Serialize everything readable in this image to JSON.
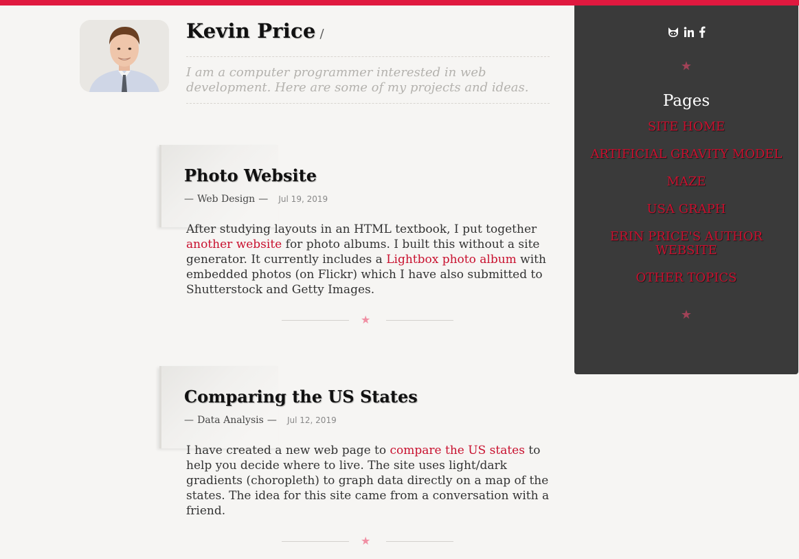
{
  "header": {
    "name": "Kevin Price",
    "slash": "/",
    "tagline": "I am a computer programmer interested in web development. Here are some of my projects and ideas."
  },
  "posts": [
    {
      "title": "Photo Website",
      "dash_left": "—",
      "category": "Web Design",
      "dash_right": "—",
      "date": "Jul 19, 2019",
      "body": {
        "t1": "After studying layouts in an HTML textbook, I put together ",
        "link1": "another website",
        "t2": " for photo albums. I built this without a site generator. It currently includes a ",
        "link2": "Lightbox photo album",
        "t3": " with embedded photos (on Flickr) which I have also submitted to Shutterstock and Getty Images."
      }
    },
    {
      "title": "Comparing the US States",
      "dash_left": "—",
      "category": "Data Analysis",
      "dash_right": "—",
      "date": "Jul 12, 2019",
      "body": {
        "t1": "I have created a new web page to ",
        "link1": "compare the US states",
        "t2": " to help you decide where to live. The site uses light/dark gradients (choropleth) to graph data directly on a map of the states. The idea for this site came from a conversation with a friend."
      }
    }
  ],
  "divider_star": "★",
  "sidebar": {
    "social_icons": [
      "github-icon",
      "linkedin-icon",
      "facebook-icon"
    ],
    "star": "★",
    "pages_heading": "Pages",
    "nav": [
      "SITE HOME",
      "ARTIFICIAL GRAVITY MODEL",
      "MAZE",
      "USA GRAPH",
      "ERIN PRICE'S AUTHOR WEBSITE",
      "OTHER TOPICS"
    ]
  },
  "colors": {
    "accent": "#e0193f",
    "link": "#c8102e",
    "sidebar_bg": "#3a3a3a",
    "background": "#f6f5f3"
  }
}
